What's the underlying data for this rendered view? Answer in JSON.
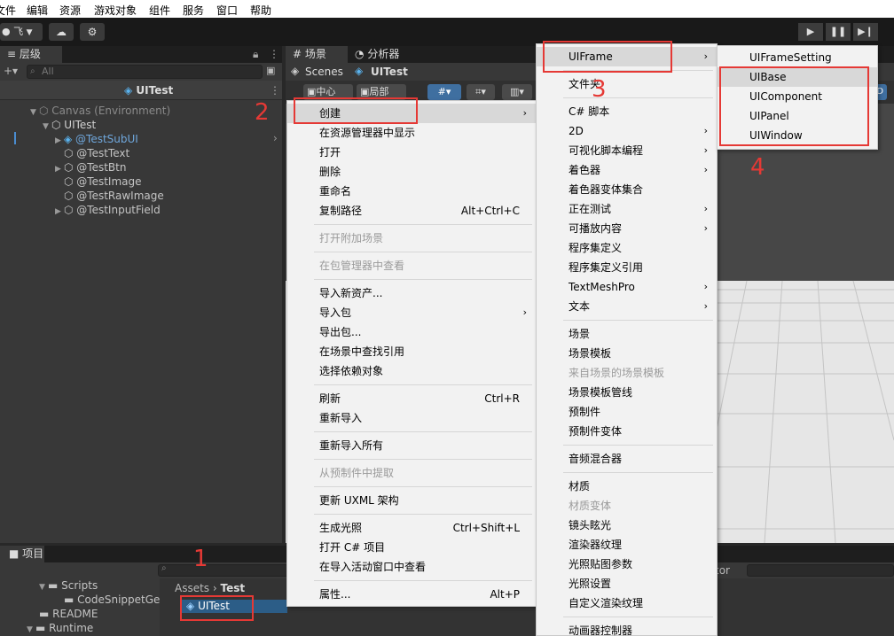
{
  "menubar": [
    "文件",
    "编辑",
    "资源",
    "游戏对象",
    "组件",
    "服务",
    "窗口",
    "帮助"
  ],
  "toolbar": {
    "account": "飞",
    "play": "▶",
    "pause": "❚❚",
    "step": "▶❙"
  },
  "hierarchy": {
    "tab": "层级",
    "search_placeholder": "All",
    "header": "UITest",
    "rows": [
      {
        "label": "Canvas (Environment)",
        "style": "dim"
      },
      {
        "label": "UITest",
        "style": "normal"
      },
      {
        "label": "@TestSubUI",
        "style": "prefab"
      },
      {
        "label": "@TestText",
        "style": "normal"
      },
      {
        "label": "@TestBtn",
        "style": "normal"
      },
      {
        "label": "@TestImage",
        "style": "normal"
      },
      {
        "label": "@TestRawImage",
        "style": "normal"
      },
      {
        "label": "@TestInputField",
        "style": "normal"
      }
    ]
  },
  "scene": {
    "tab_scene": "场景",
    "tab_profiler": "分析器",
    "crumb_scenes": "Scenes",
    "crumb_prefab": "UITest",
    "tool_center": "中心",
    "tool_local": "局部",
    "tool_mode": "2D"
  },
  "project": {
    "tab": "项目",
    "tree": [
      "Scripts",
      "CodeSnippetGe",
      "README",
      "Runtime"
    ],
    "crumb_root": "Assets",
    "crumb_leaf": "Test",
    "selected_item": "UITest",
    "right_label": "tor"
  },
  "context_menu": [
    {
      "label": "创建",
      "submenu": true,
      "highlight": true
    },
    {
      "label": "在资源管理器中显示"
    },
    {
      "label": "打开"
    },
    {
      "label": "删除"
    },
    {
      "label": "重命名"
    },
    {
      "label": "复制路径",
      "shortcut": "Alt+Ctrl+C"
    },
    {
      "separator": true
    },
    {
      "label": "打开附加场景",
      "disabled": true
    },
    {
      "separator": true
    },
    {
      "label": "在包管理器中查看",
      "disabled": true
    },
    {
      "separator": true
    },
    {
      "label": "导入新资产..."
    },
    {
      "label": "导入包",
      "submenu": true
    },
    {
      "label": "导出包..."
    },
    {
      "label": "在场景中查找引用"
    },
    {
      "label": "选择依赖对象"
    },
    {
      "separator": true
    },
    {
      "label": "刷新",
      "shortcut": "Ctrl+R"
    },
    {
      "label": "重新导入"
    },
    {
      "separator": true
    },
    {
      "label": "重新导入所有"
    },
    {
      "separator": true
    },
    {
      "label": "从预制件中提取",
      "disabled": true
    },
    {
      "separator": true
    },
    {
      "label": "更新 UXML 架构"
    },
    {
      "separator": true
    },
    {
      "label": "生成光照",
      "shortcut": "Ctrl+Shift+L"
    },
    {
      "label": "打开 C# 项目"
    },
    {
      "label": "在导入活动窗口中查看"
    },
    {
      "separator": true
    },
    {
      "label": "属性...",
      "shortcut": "Alt+P"
    }
  ],
  "create_menu": [
    {
      "label": "UIFrame",
      "submenu": true,
      "highlight": true
    },
    {
      "separator": true
    },
    {
      "label": "文件夹"
    },
    {
      "separator": true
    },
    {
      "label": "C# 脚本"
    },
    {
      "label": "2D",
      "submenu": true
    },
    {
      "label": "可视化脚本编程",
      "submenu": true
    },
    {
      "label": "着色器",
      "submenu": true
    },
    {
      "label": "着色器变体集合"
    },
    {
      "label": "正在测试",
      "submenu": true
    },
    {
      "label": "可播放内容",
      "submenu": true
    },
    {
      "label": "程序集定义"
    },
    {
      "label": "程序集定义引用"
    },
    {
      "label": "TextMeshPro",
      "submenu": true
    },
    {
      "label": "文本",
      "submenu": true
    },
    {
      "separator": true
    },
    {
      "label": "场景"
    },
    {
      "label": "场景模板"
    },
    {
      "label": "来自场景的场景模板",
      "disabled": true
    },
    {
      "label": "场景模板管线"
    },
    {
      "label": "预制件"
    },
    {
      "label": "预制件变体"
    },
    {
      "separator": true
    },
    {
      "label": "音频混合器"
    },
    {
      "separator": true
    },
    {
      "label": "材质"
    },
    {
      "label": "材质变体",
      "disabled": true
    },
    {
      "label": "镜头眩光"
    },
    {
      "label": "渲染器纹理"
    },
    {
      "label": "光照贴图参数"
    },
    {
      "label": "光照设置"
    },
    {
      "label": "自定义渲染纹理"
    },
    {
      "separator": true
    },
    {
      "label": "动画器控制器"
    }
  ],
  "uiframe_menu": [
    {
      "label": "UIFrameSetting"
    },
    {
      "separator": true
    },
    {
      "label": "UIBase",
      "highlight": true
    },
    {
      "label": "UIComponent"
    },
    {
      "label": "UIPanel"
    },
    {
      "label": "UIWindow"
    }
  ],
  "step_markers": [
    "1",
    "2",
    "3",
    "4"
  ],
  "colors": {
    "marker": "#e53935",
    "selection": "#2c5d87",
    "menu_bg": "#f2f2f2"
  }
}
